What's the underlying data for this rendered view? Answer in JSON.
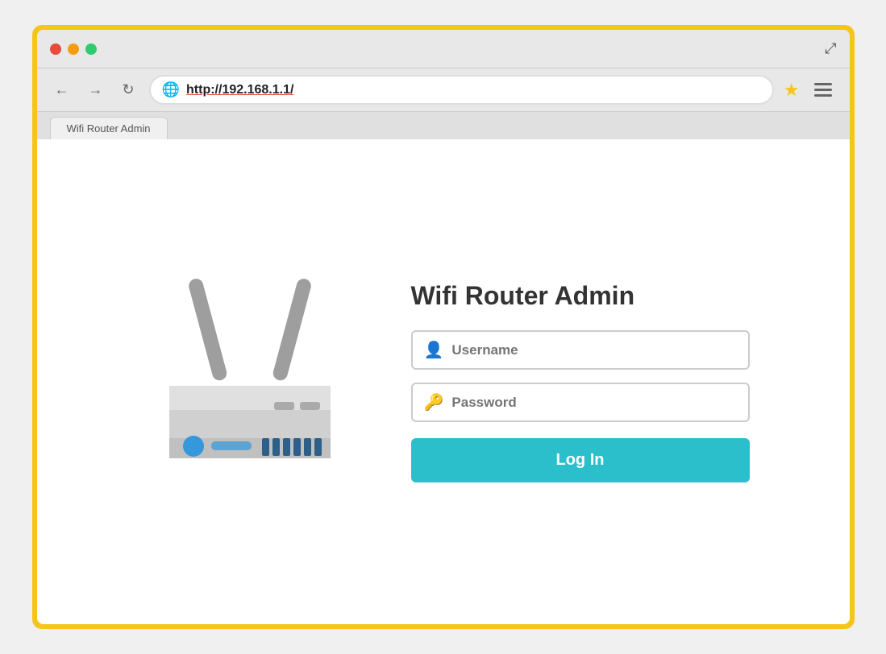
{
  "browser": {
    "url": "http://192.168.1.1/",
    "tab_label": "Wifi Router Admin",
    "traffic_lights": [
      "close",
      "minimize",
      "maximize"
    ]
  },
  "page": {
    "title": "Wifi Router Admin",
    "username_placeholder": "Username",
    "password_placeholder": "Password",
    "login_button": "Log In",
    "username_icon": "👤",
    "password_icon": "🔑"
  },
  "icons": {
    "back": "←",
    "forward": "→",
    "reload": "↻",
    "globe": "🌐",
    "star": "★",
    "expand": "⤢"
  },
  "colors": {
    "close_btn": "#e74c3c",
    "minimize_btn": "#f39c12",
    "maximize_btn": "#2ecc71",
    "login_btn_bg": "#2bbfcc",
    "outer_frame": "#f5c518"
  }
}
